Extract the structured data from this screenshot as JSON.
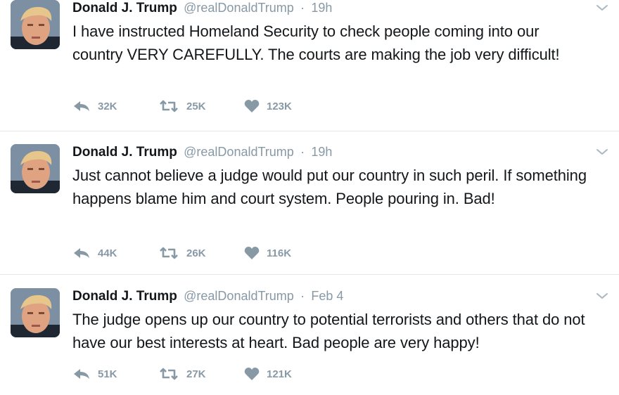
{
  "tweets": [
    {
      "name": "Donald J. Trump",
      "handle": "@realDonaldTrump",
      "separator": "·",
      "time": "19h",
      "text": "I have instructed Homeland Security to check people coming into our country VERY CAREFULLY. The courts are making the job very difficult!",
      "replies": "32K",
      "retweets": "25K",
      "likes": "123K"
    },
    {
      "name": "Donald J. Trump",
      "handle": "@realDonaldTrump",
      "separator": "·",
      "time": "19h",
      "text": "Just cannot  believe a judge would put our country in such peril. If something happens blame him and court system. People pouring in. Bad!",
      "replies": "44K",
      "retweets": "26K",
      "likes": "116K"
    },
    {
      "name": "Donald J. Trump",
      "handle": "@realDonaldTrump",
      "separator": "·",
      "time": "Feb 4",
      "text": "The judge opens up our country to potential terrorists and others that do not have our best interests at heart. Bad people are very happy!",
      "replies": "51K",
      "retweets": "27K",
      "likes": "121K"
    }
  ],
  "icons": {
    "reply": "reply-icon",
    "retweet": "retweet-icon",
    "like": "heart-icon",
    "more": "chevron-down-icon"
  },
  "colors": {
    "name": "#14171a",
    "meta": "#8899a6",
    "divider": "#e1e8ed"
  }
}
